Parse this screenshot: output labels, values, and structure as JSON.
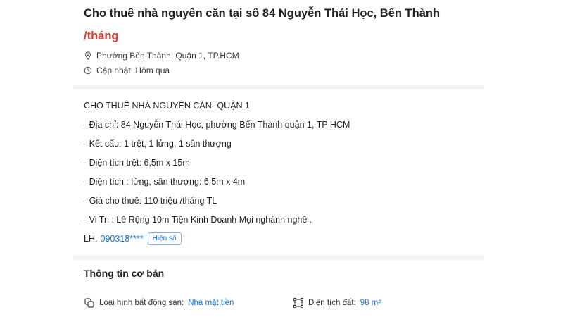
{
  "listing": {
    "title": "Cho thuê nhà nguyên căn tại số 84 Nguyễn Thái Học, Bến Thành",
    "price": "/tháng",
    "location": "Phường Bến Thành, Quận 1, TP.HCM",
    "updated": "Cập nhật: Hôm qua"
  },
  "description": {
    "lines": [
      "CHO THUÊ NHÀ NGUYÊN CĂN- QUẬN 1",
      "- Địa chỉ: 84 Nguyễn Thái Học, phường Bến Thành quận 1, TP HCM",
      "- Kết cấu: 1 trệt, 1 lửng, 1 sân thượng",
      "- Diện tích trệt: 6,5m x 15m",
      "- Diện tích : lửng, sân thượng: 6,5m x 4m",
      "- Giá cho thuê: 110 triệu /tháng TL",
      "- Vi Tri : Lề Rộng 10m Tiện Kinh Doanh Mọi nghành nghề ."
    ],
    "contact_label": "LH:",
    "contact_phone": "090318****",
    "show_number_label": "Hiện số"
  },
  "basic_info": {
    "heading": "Thông tin cơ bản",
    "property_type_label": "Loại hình bất động sản:",
    "property_type_value": "Nhà mặt tiền",
    "land_area_label": "Diện tích đất:",
    "land_area_value": "98 m²"
  },
  "icons": {
    "location": "location-pin-icon",
    "clock": "clock-icon",
    "property_type": "property-type-icon",
    "land_area": "area-icon"
  },
  "colors": {
    "price": "#e03c31",
    "link": "#1a6fd6",
    "divider": "#f2f4f6"
  }
}
